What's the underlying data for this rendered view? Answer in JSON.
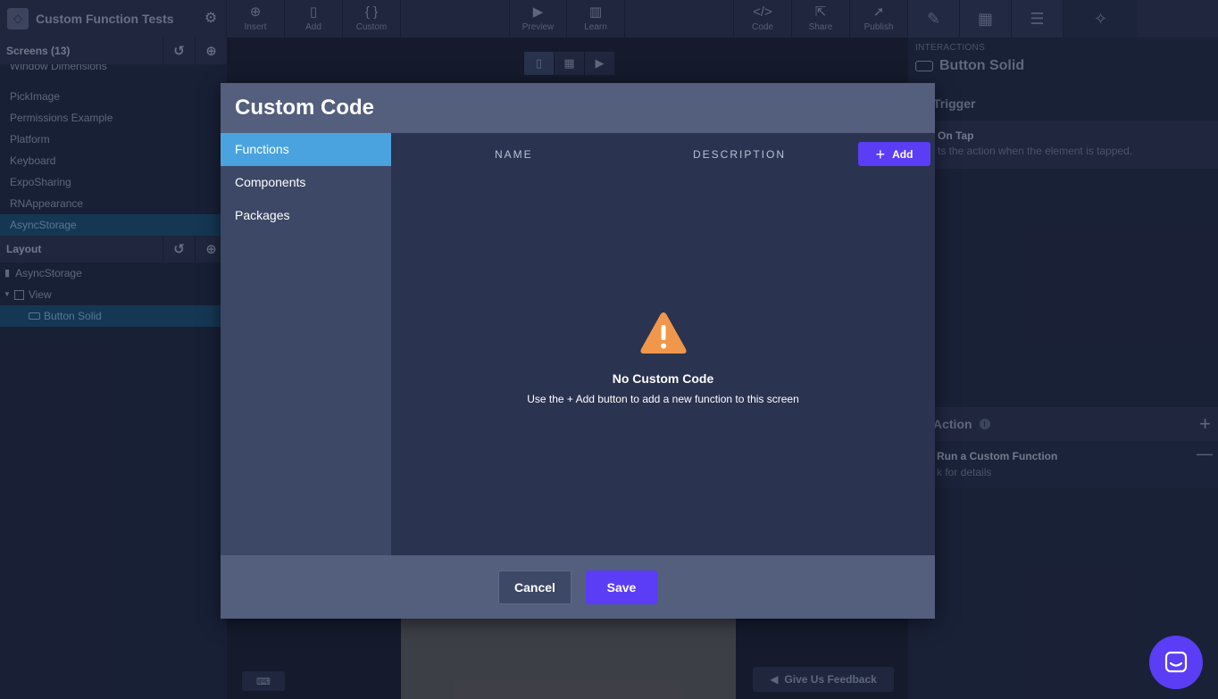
{
  "app": {
    "title": "Custom Function Tests"
  },
  "toolbar": {
    "insert": "Insert",
    "add": "Add",
    "custom": "Custom",
    "preview": "Preview",
    "learn": "Learn",
    "code": "Code",
    "share": "Share",
    "publish": "Publish"
  },
  "screens": {
    "header": "Screens (13)",
    "items": [
      "Window Dimensions",
      "PickImage",
      "Permissions Example",
      "Platform",
      "Keyboard",
      "ExpoSharing",
      "RNAppearance",
      "AsyncStorage"
    ],
    "active_index": 7
  },
  "layout": {
    "header": "Layout",
    "items": [
      {
        "label": "AsyncStorage",
        "indent": 0
      },
      {
        "label": "View",
        "indent": 1
      },
      {
        "label": "Button Solid",
        "indent": 2
      }
    ]
  },
  "interactions": {
    "label": "INTERACTIONS",
    "element": "Button Solid",
    "trigger_header": "Trigger",
    "trigger_name": "On Tap",
    "trigger_desc": "ts the action when the element is tapped.",
    "action_header": "Action",
    "action_name": "Run a Custom Function",
    "action_desc": "k for details"
  },
  "feedback": "Give Us Feedback",
  "modal": {
    "title": "Custom Code",
    "nav": [
      "Functions",
      "Components",
      "Packages"
    ],
    "active_nav": 0,
    "col_name": "NAME",
    "col_description": "DESCRIPTION",
    "add_label": "Add",
    "empty_title": "No Custom Code",
    "empty_subtitle": "Use the + Add button to add a new function to this screen",
    "cancel_label": "Cancel",
    "save_label": "Save"
  },
  "colors": {
    "accent": "#5b3df5",
    "nav_active": "#4aa3df",
    "warning": "#f0974b"
  }
}
